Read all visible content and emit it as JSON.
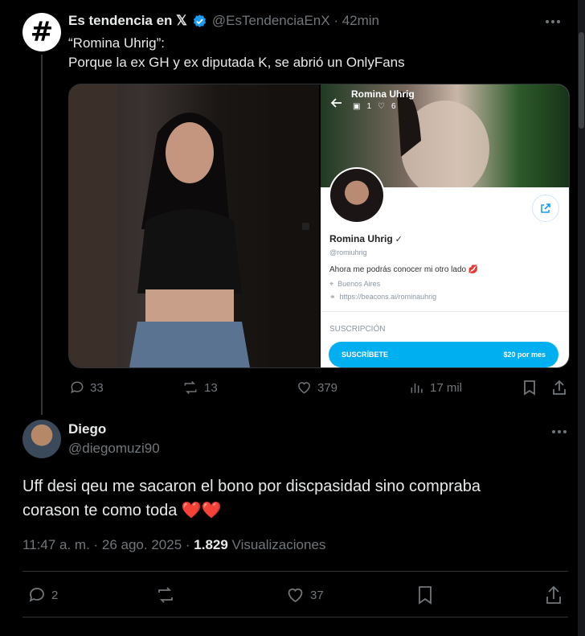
{
  "quoted_post": {
    "author_name": "Es tendencia en 𝕏",
    "handle_time": "@EsTendenciaEnX · 42min",
    "text_line1": "“Romina Uhrig”:",
    "text_line2": "Porque la ex GH y ex diputada K, se abrió un OnlyFans",
    "replies": "33",
    "reposts": "13",
    "likes": "379",
    "views": "17 mil"
  },
  "media_profile": {
    "profile_name": "Romina Uhrig",
    "stats_images": "1",
    "stats_likes": "6",
    "handle": "@romiuhrig",
    "bio": "Ahora me podrás conocer mi otro lado 💋",
    "location": "Buenos Aires",
    "link": "https://beacons.ai/rominauhrig",
    "subscription_label": "SUSCRIPCIÓN",
    "subscribe_button": "SUSCRÍBETE",
    "price": "$20 por mes"
  },
  "reply_post": {
    "author_name": "Diego",
    "handle": "@diegomuzi90",
    "text_line1": "Uff desi qeu me sacaron el bono por discpasidad sino compraba",
    "text_line2": "corason te como toda ❤️❤️",
    "timestamp": "11:47 a. m. · 26 ago. 2025 · ",
    "views_count": "1.829",
    "views_label": " Visualizaciones",
    "replies": "2",
    "likes": "37"
  },
  "colors": {
    "background": "#000000",
    "verified_blue": "#1d9bf0",
    "muted_text": "#71767b"
  }
}
